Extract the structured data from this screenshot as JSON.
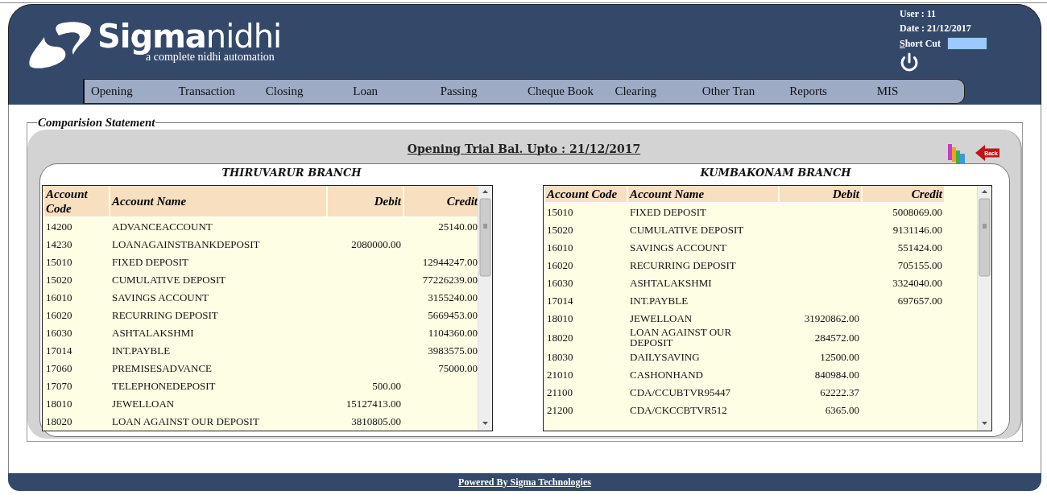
{
  "header": {
    "logo": {
      "bold": "Sigma",
      "light": "nidhi",
      "tagline": "a complete nidhi automation"
    },
    "user": "User : 11",
    "date": "Date : 21/12/2017",
    "shortcut": {
      "label": "Short Cut"
    }
  },
  "nav": [
    {
      "label": "Opening"
    },
    {
      "label": "Transaction"
    },
    {
      "label": "Closing"
    },
    {
      "label": "Loan"
    },
    {
      "label": "Passing"
    },
    {
      "label": "Cheque Book"
    },
    {
      "label": "Clearing"
    },
    {
      "label": "Other Tran"
    },
    {
      "label": "Reports"
    },
    {
      "label": "MIS"
    }
  ],
  "statement": {
    "legend": "Comparision Statement",
    "title": "Opening Trial Bal. Upto : 21/12/2017",
    "back_label": "Back",
    "branches": [
      {
        "title": "THIRUVARUR BRANCH",
        "columns": [
          "Account Code",
          "Account Name",
          "Debit",
          "Credit"
        ],
        "rows": [
          [
            "14200",
            "ADVANCEACCOUNT",
            "",
            "25140.00"
          ],
          [
            "14230",
            "LOANAGAINSTBANKDEPOSIT",
            "2080000.00",
            ""
          ],
          [
            "15010",
            "FIXED DEPOSIT",
            "",
            "12944247.00"
          ],
          [
            "15020",
            "CUMULATIVE DEPOSIT",
            "",
            "77226239.00"
          ],
          [
            "16010",
            "SAVINGS ACCOUNT",
            "",
            "3155240.00"
          ],
          [
            "16020",
            "RECURRING DEPOSIT",
            "",
            "5669453.00"
          ],
          [
            "16030",
            "ASHTALAKSHMI",
            "",
            "1104360.00"
          ],
          [
            "17014",
            "INT.PAYBLE",
            "",
            "3983575.00"
          ],
          [
            "17060",
            "PREMISESADVANCE",
            "",
            "75000.00"
          ],
          [
            "17070",
            "TELEPHONEDEPOSIT",
            "500.00",
            ""
          ],
          [
            "18010",
            "JEWELLOAN",
            "15127413.00",
            ""
          ],
          [
            "18020",
            "LOAN AGAINST OUR DEPOSIT",
            "3810805.00",
            ""
          ]
        ]
      },
      {
        "title": "KUMBAKONAM BRANCH",
        "columns": [
          "Account Code",
          "Account Name",
          "Debit",
          "Credit"
        ],
        "rows": [
          [
            "15010",
            "FIXED DEPOSIT",
            "",
            "5008069.00"
          ],
          [
            "15020",
            "CUMULATIVE DEPOSIT",
            "",
            "9131146.00"
          ],
          [
            "16010",
            "SAVINGS ACCOUNT",
            "",
            "551424.00"
          ],
          [
            "16020",
            "RECURRING DEPOSIT",
            "",
            "705155.00"
          ],
          [
            "16030",
            "ASHTALAKSHMI",
            "",
            "3324040.00"
          ],
          [
            "17014",
            "INT.PAYBLE",
            "",
            "697657.00"
          ],
          [
            "18010",
            "JEWELLOAN",
            "31920862.00",
            ""
          ],
          [
            "18020",
            "LOAN AGAINST OUR DEPOSIT",
            "284572.00",
            ""
          ],
          [
            "18030",
            "DAILYSAVING",
            "12500.00",
            ""
          ],
          [
            "21010",
            "CASHONHAND",
            "840984.00",
            ""
          ],
          [
            "21100",
            "CDA/CCUBTVR95447",
            "62222.37",
            ""
          ],
          [
            "21200",
            "CDA/CKCCBTVR512",
            "6365.00",
            ""
          ]
        ]
      }
    ]
  },
  "footer": {
    "link": "Powered By Sigma Technologies"
  }
}
